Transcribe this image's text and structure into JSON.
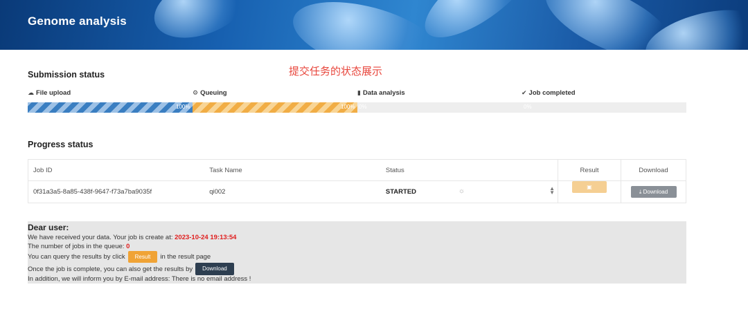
{
  "header": {
    "title": "Genome analysis"
  },
  "annotation": "提交任务的状态展示",
  "submission": {
    "title": "Submission status",
    "steps": [
      {
        "icon": "cloud-icon",
        "glyph": "☁",
        "label": "File upload"
      },
      {
        "icon": "sliders-icon",
        "glyph": "⚙",
        "label": "Queuing"
      },
      {
        "icon": "bar-chart-icon",
        "glyph": "▮",
        "label": "Data analysis"
      },
      {
        "icon": "check-circle-icon",
        "glyph": "✔",
        "label": "Job completed"
      }
    ],
    "progress": [
      {
        "label": "100%",
        "color": "#3a7ec1",
        "fraction": 1.0
      },
      {
        "label": "100%",
        "color": "#f1ad45",
        "fraction": 1.0
      },
      {
        "label": "0%",
        "fraction": 0.0
      },
      {
        "label": "0%",
        "fraction": 0.0
      }
    ]
  },
  "progress_status": {
    "title": "Progress status",
    "columns": [
      "Job ID",
      "Task Name",
      "Status",
      "Result",
      "Download"
    ],
    "rows": [
      {
        "job_id": "0f31a3a5-8a85-438f-9647-f73a7ba9035f",
        "task_name": "qi002",
        "status": "STARTED",
        "result_label": "Result",
        "download_label": "Download"
      }
    ]
  },
  "info": {
    "greeting": "Dear user:",
    "line1_prefix": "We have received your data. Your job is create at: ",
    "created_at": "2023-10-24 19:13:54",
    "line2_prefix": "The number of jobs in the queue: ",
    "queue_count": "0",
    "line3_prefix": "You can query the results by click",
    "result_button": "Result",
    "line3_suffix": "in the result page",
    "line4_prefix": "Once the job is complete, you can also get the results by",
    "download_button": "Download",
    "line5": "In addition, we will inform you by E-mail address: There is no email address !"
  }
}
